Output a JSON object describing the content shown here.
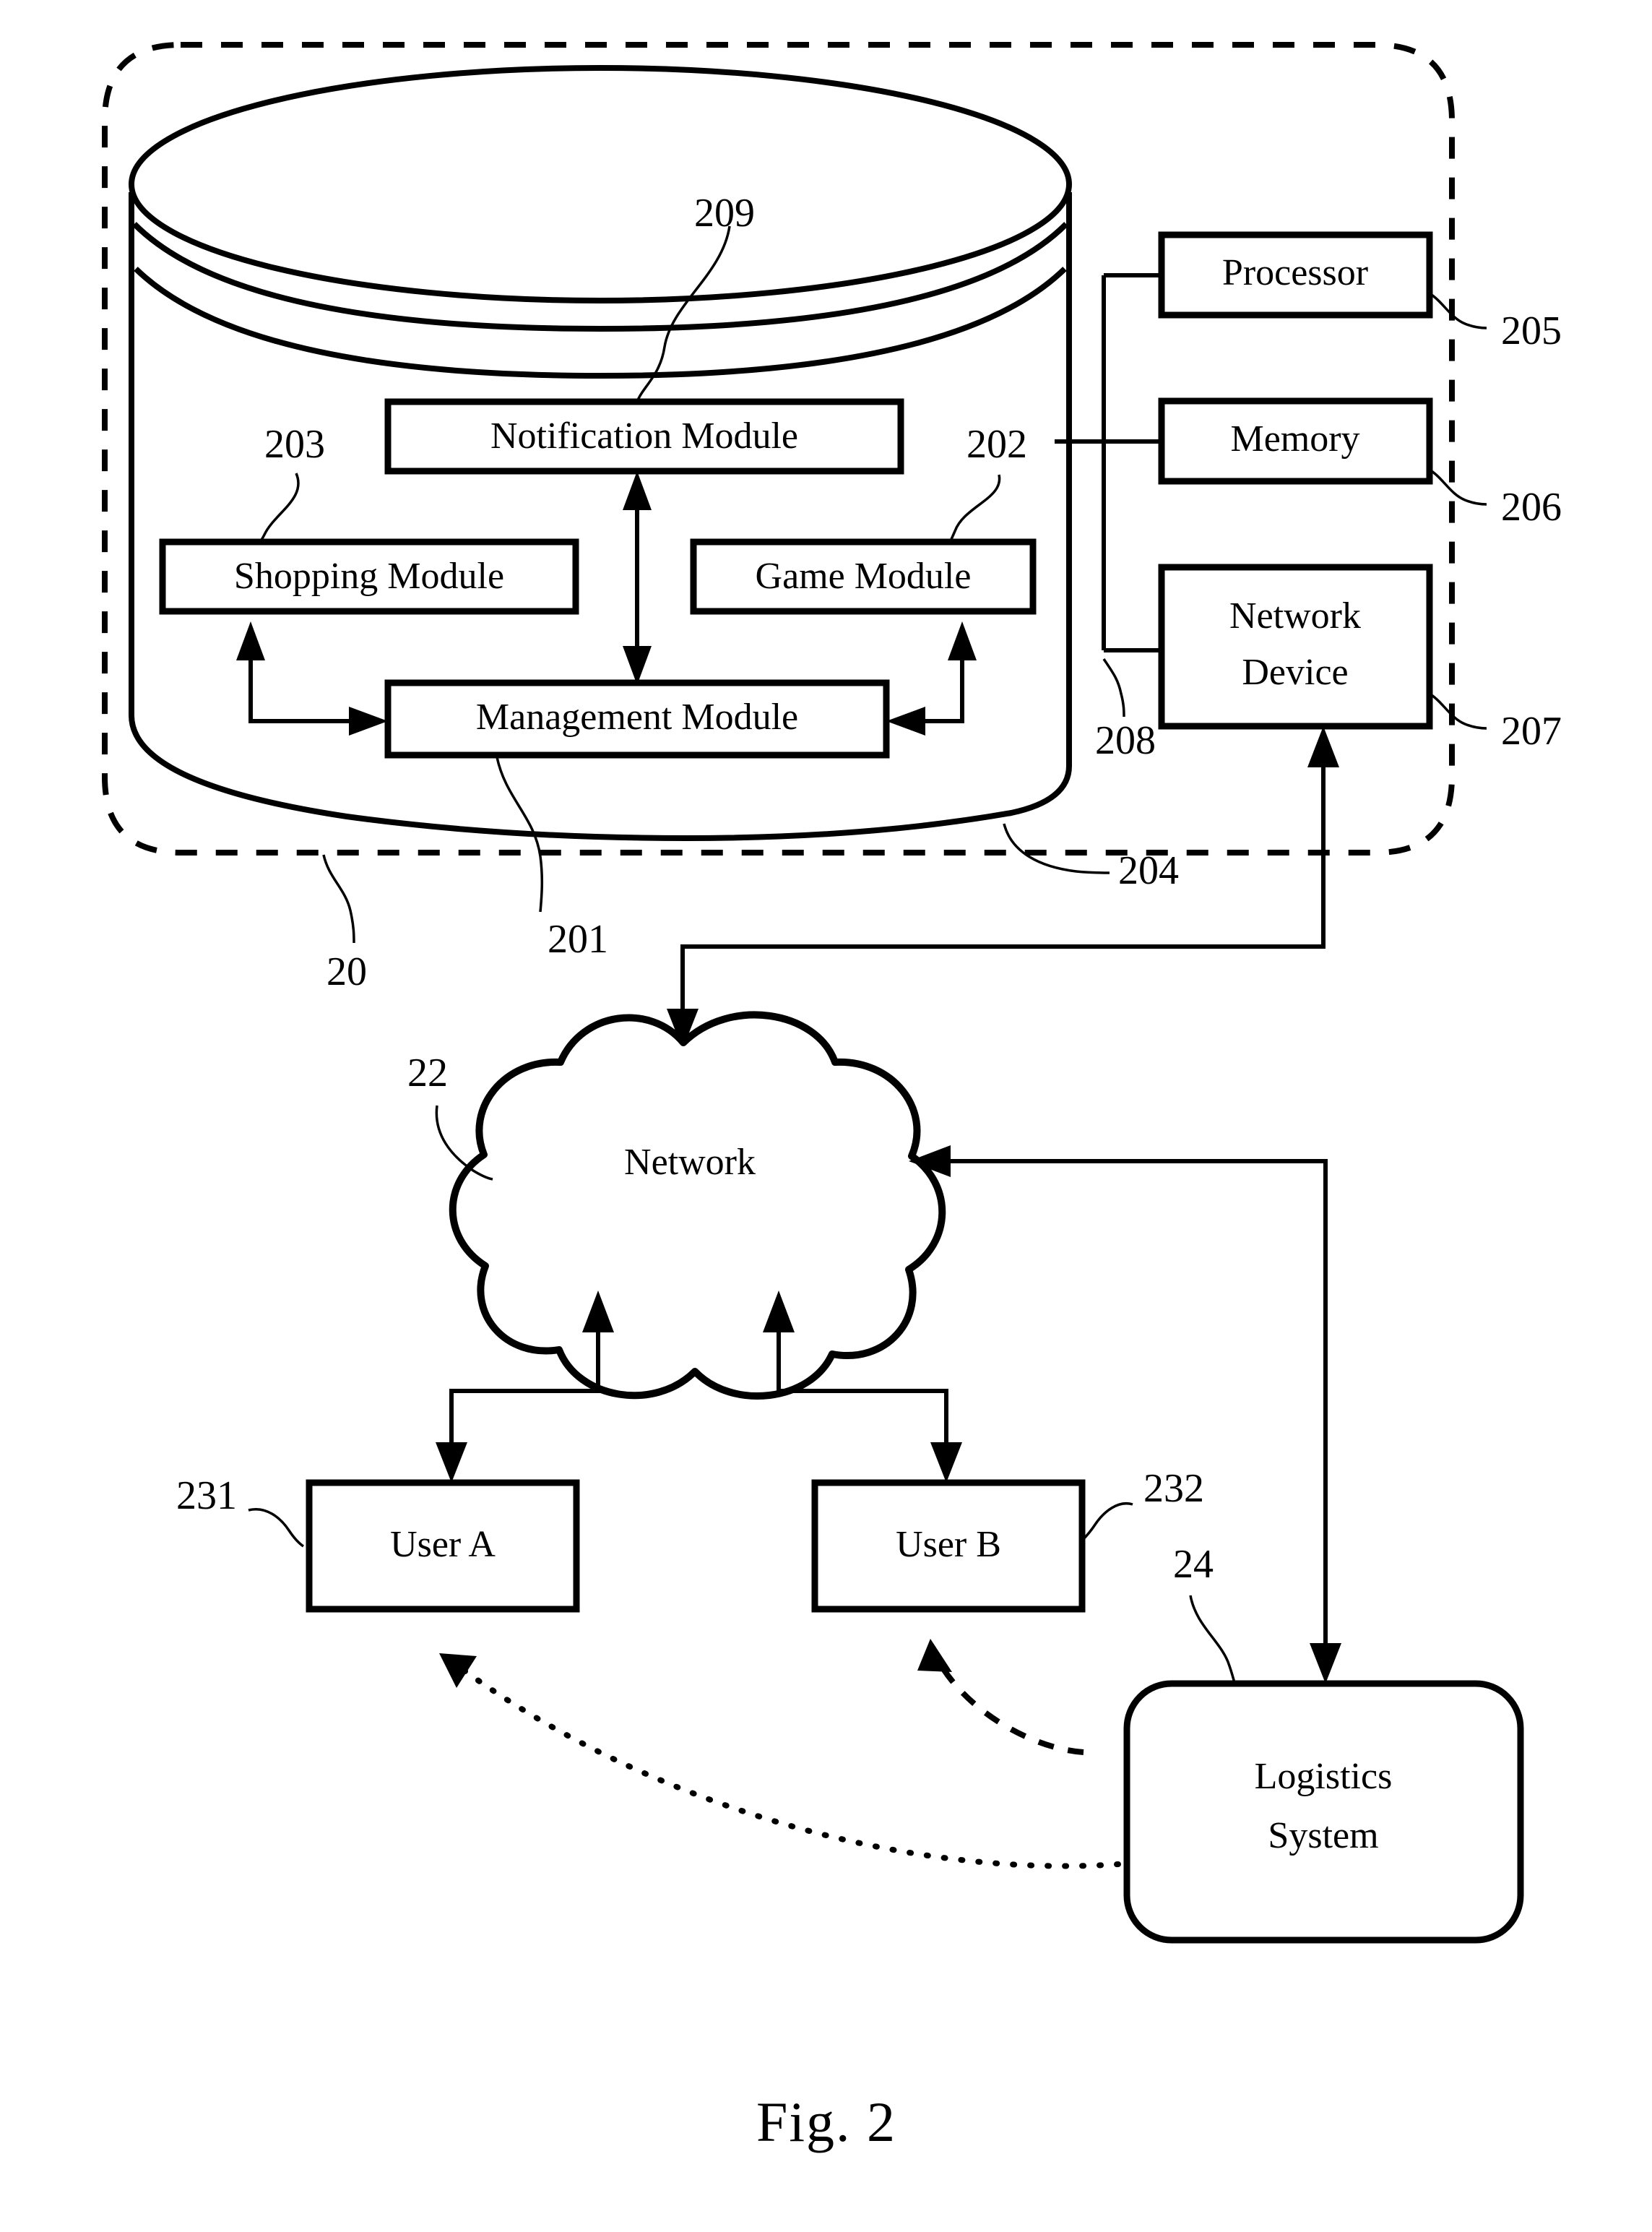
{
  "figure": {
    "caption": "Fig. 2"
  },
  "server_system": {
    "ref": "20",
    "boundary_name": "dashed-system-boundary",
    "storage_ref": "204",
    "modules": [
      {
        "id": "notification",
        "label": "Notification Module",
        "ref": "209"
      },
      {
        "id": "shopping",
        "label": "Shopping Module",
        "ref": "203"
      },
      {
        "id": "game",
        "label": "Game Module",
        "ref": "202"
      },
      {
        "id": "management",
        "label": "Management Module",
        "ref": "201"
      }
    ],
    "hardware": [
      {
        "id": "processor",
        "label": "Processor",
        "ref": "205"
      },
      {
        "id": "memory",
        "label": "Memory",
        "ref": "206"
      },
      {
        "id": "network_device",
        "label": "Network Device",
        "ref": "207",
        "line2": "Device",
        "line1": "Network"
      }
    ],
    "bus_ref": "208"
  },
  "network": {
    "label": "Network",
    "ref": "22"
  },
  "users": [
    {
      "id": "user_a",
      "label": "User A",
      "ref": "231"
    },
    {
      "id": "user_b",
      "label": "User B",
      "ref": "232"
    }
  ],
  "logistics": {
    "line1": "Logistics",
    "line2": "System",
    "ref": "24"
  },
  "colors": {
    "ink": "#000000",
    "paper": "#ffffff"
  }
}
